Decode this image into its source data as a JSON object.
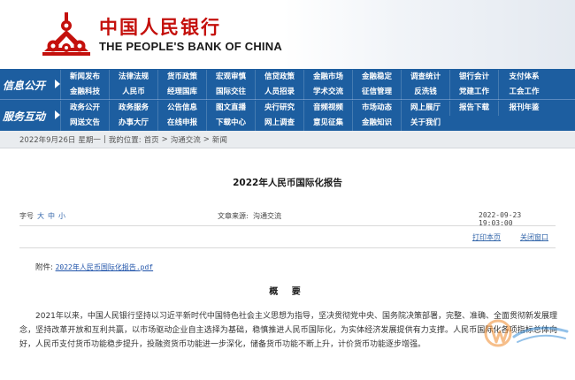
{
  "header": {
    "logo_cn": "中国人民银行",
    "logo_en": "THE PEOPLE'S BANK OF CHINA",
    "logo_color": "#c4100c",
    "emblem_icon": "pboc-emblem-icon"
  },
  "nav": {
    "background": "#1d5ea0",
    "bands": [
      {
        "label": "信息公开",
        "rows": [
          [
            "新闻发布",
            "法律法规",
            "货币政策",
            "宏观审慎",
            "信贷政策",
            "金融市场",
            "金融稳定",
            "调查统计",
            "银行会计",
            "支付体系"
          ],
          [
            "金融科技",
            "人民币",
            "经理国库",
            "国际交往",
            "人员招录",
            "学术交流",
            "征信管理",
            "反洗钱",
            "党建工作",
            "工会工作"
          ]
        ]
      },
      {
        "label": "服务互动",
        "rows": [
          [
            "政务公开",
            "政务服务",
            "公告信息",
            "图文直播",
            "央行研究",
            "音频视频",
            "市场动态",
            "网上展厅",
            "报告下载",
            "报刊年鉴"
          ],
          [
            "网送文告",
            "办事大厅",
            "在线申报",
            "下载中心",
            "网上调查",
            "意见征集",
            "金融知识",
            "关于我们"
          ]
        ]
      }
    ]
  },
  "breadcrumb": {
    "date": "2022年9月26日",
    "weekday": "星期一",
    "location_label": "我的位置:",
    "items": [
      "首页",
      "沟通交流",
      "新闻"
    ]
  },
  "article": {
    "title": "2022年人民币国际化报告",
    "font_size_label": "字号",
    "font_sizes": [
      "大",
      "中",
      "小"
    ],
    "source_label": "文章来源:",
    "source": "沟通交流",
    "datetime": "2022-09-23 19:03:00",
    "print_label": "打印本页",
    "close_label": "关闭窗口",
    "attachment_label": "附件:",
    "attachment_file": "2022年人民币国际化报告.pdf",
    "summary_heading": "概 要",
    "body": "2021年以来，中国人民银行坚持以习近平新时代中国特色社会主义思想为指导，坚决贯彻党中央、国务院决策部署，完整、准确、全面贯彻新发展理念，坚持改革开放和互利共赢，以市场驱动企业自主选择为基础，稳慎推进人民币国际化，为实体经济发展提供有力支撑。人民币国际化各项指标总体向好，人民币支付货币功能稳步提升，投融资货币功能进一步深化，储备货币功能不断上升，计价货币功能逐步增强。"
  },
  "watermark": {
    "icon": "watermark-logo-icon"
  }
}
